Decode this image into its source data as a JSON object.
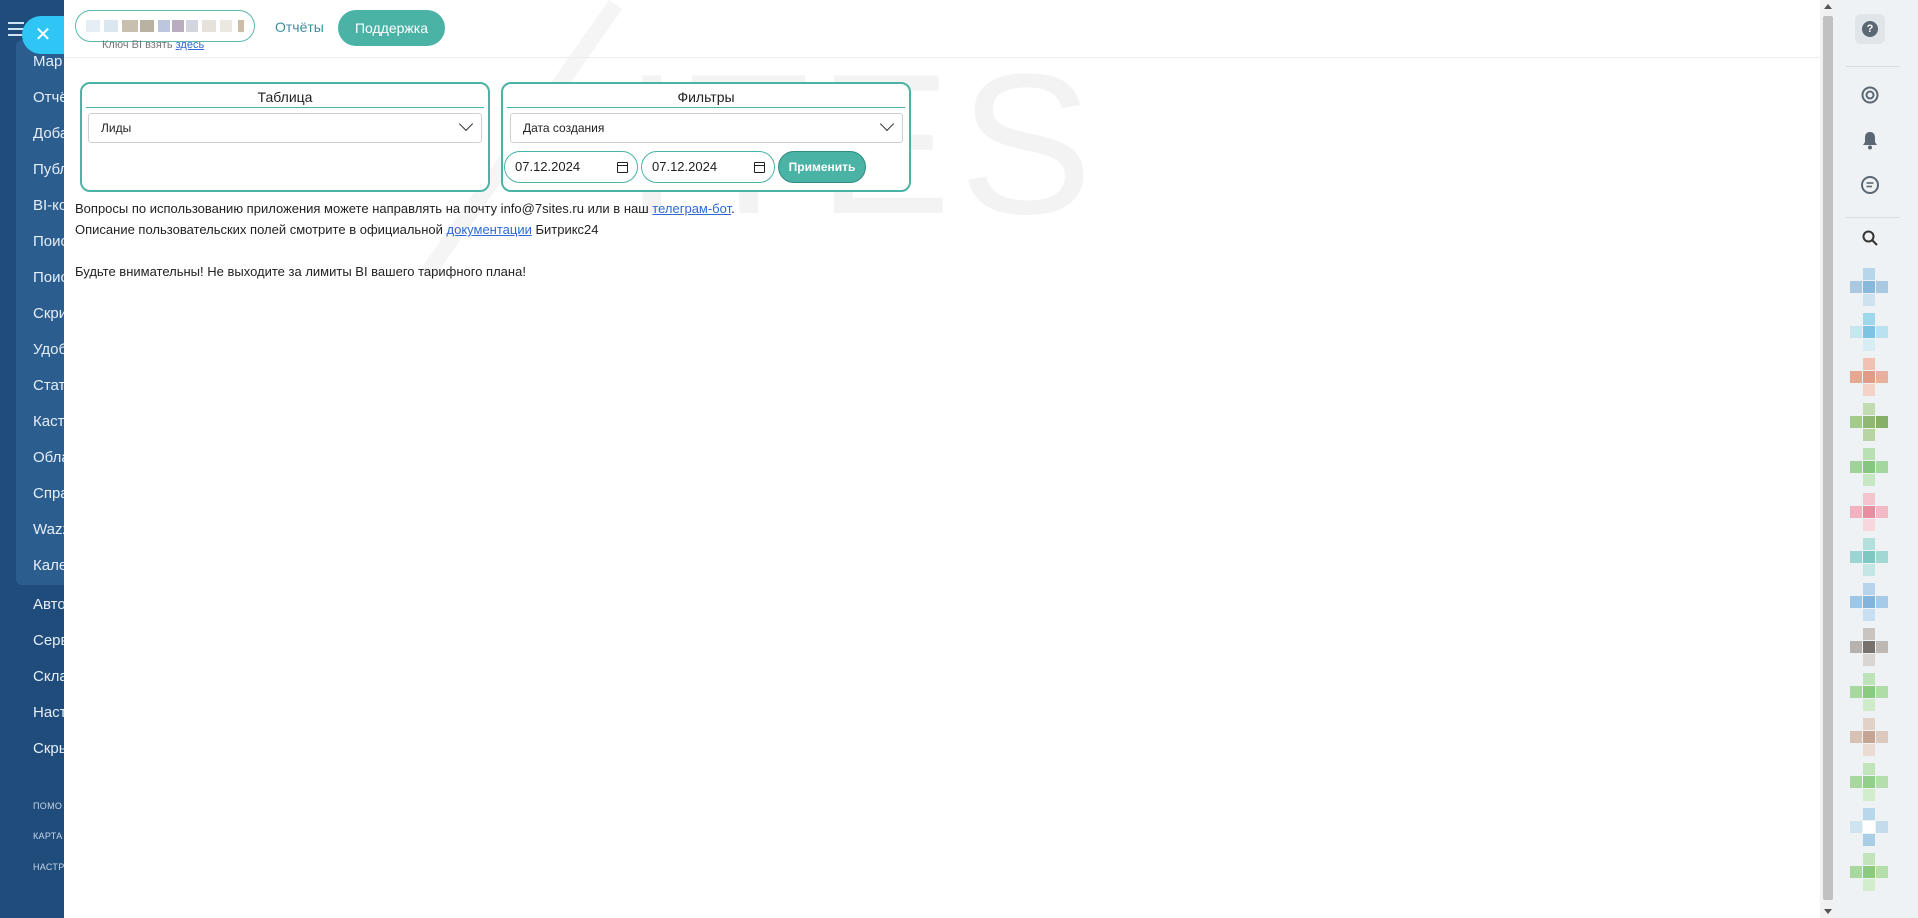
{
  "left_sidebar": {
    "items": [
      "Мар",
      "Отчё",
      "Доба",
      "Публ",
      "BI-ко",
      "Поис",
      "Поис",
      "Скри",
      "Удоб",
      "Стат",
      "Каст",
      "Обла",
      "Спра",
      "Wazz",
      "Кале",
      "Авто",
      "Серв",
      "Скла",
      "Наст",
      "Скры"
    ],
    "small_items": [
      "ПОМО",
      "КАРТА",
      "НАСТР"
    ]
  },
  "close_button": {
    "glyph": "✕"
  },
  "topbar": {
    "key_hint_text": "Ключ BI взять",
    "key_hint_link": "здесь",
    "reports_link": "Отчёты",
    "support_button": "Поддержка"
  },
  "watermark": {
    "text": "ITES"
  },
  "table_card": {
    "title": "Таблица",
    "selected": "Лиды"
  },
  "filters_card": {
    "title": "Фильтры",
    "selected": "Дата создания",
    "date_from": "07.12.2024",
    "date_to": "07.12.2024",
    "apply_button": "Применить"
  },
  "info": {
    "line1_text": "Вопросы по использованию приложения можете направлять на почту info@7sites.ru или в наш",
    "line1_link": "телеграм-бот",
    "line1_end": ".",
    "line2_text": "Описание пользовательских полей смотрите в официальной",
    "line2_link": "документации",
    "line2_end": "Битрикс24",
    "warning": "Будьте внимательны! Не выходите за лимиты BI вашего тарифного плана!"
  },
  "right_panel": {
    "icons": [
      "help-icon",
      "copilot-icon",
      "bell-icon",
      "chat-icon",
      "search-icon"
    ],
    "help_glyph": "?"
  }
}
